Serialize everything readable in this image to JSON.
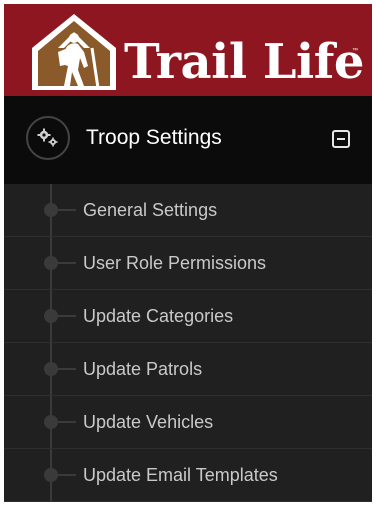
{
  "brand": {
    "name": "Trail Life",
    "trademark": "™",
    "colors": {
      "header_bg": "#8e1620",
      "logo_brown": "#8b5a2b",
      "logo_white": "#ffffff"
    }
  },
  "menu": {
    "section": {
      "title": "Troop Settings",
      "icon": "gears-icon",
      "toggle_icon": "collapse-square-icon"
    },
    "items": [
      {
        "label": "General Settings"
      },
      {
        "label": "User Role Permissions"
      },
      {
        "label": "Update Categories"
      },
      {
        "label": "Update Patrols"
      },
      {
        "label": "Update Vehicles"
      },
      {
        "label": "Update Email Templates"
      }
    ],
    "colors": {
      "bg": "#202020",
      "header_bg": "#0b0b0b",
      "text": "#c9c9c9",
      "title": "#ffffff"
    }
  }
}
